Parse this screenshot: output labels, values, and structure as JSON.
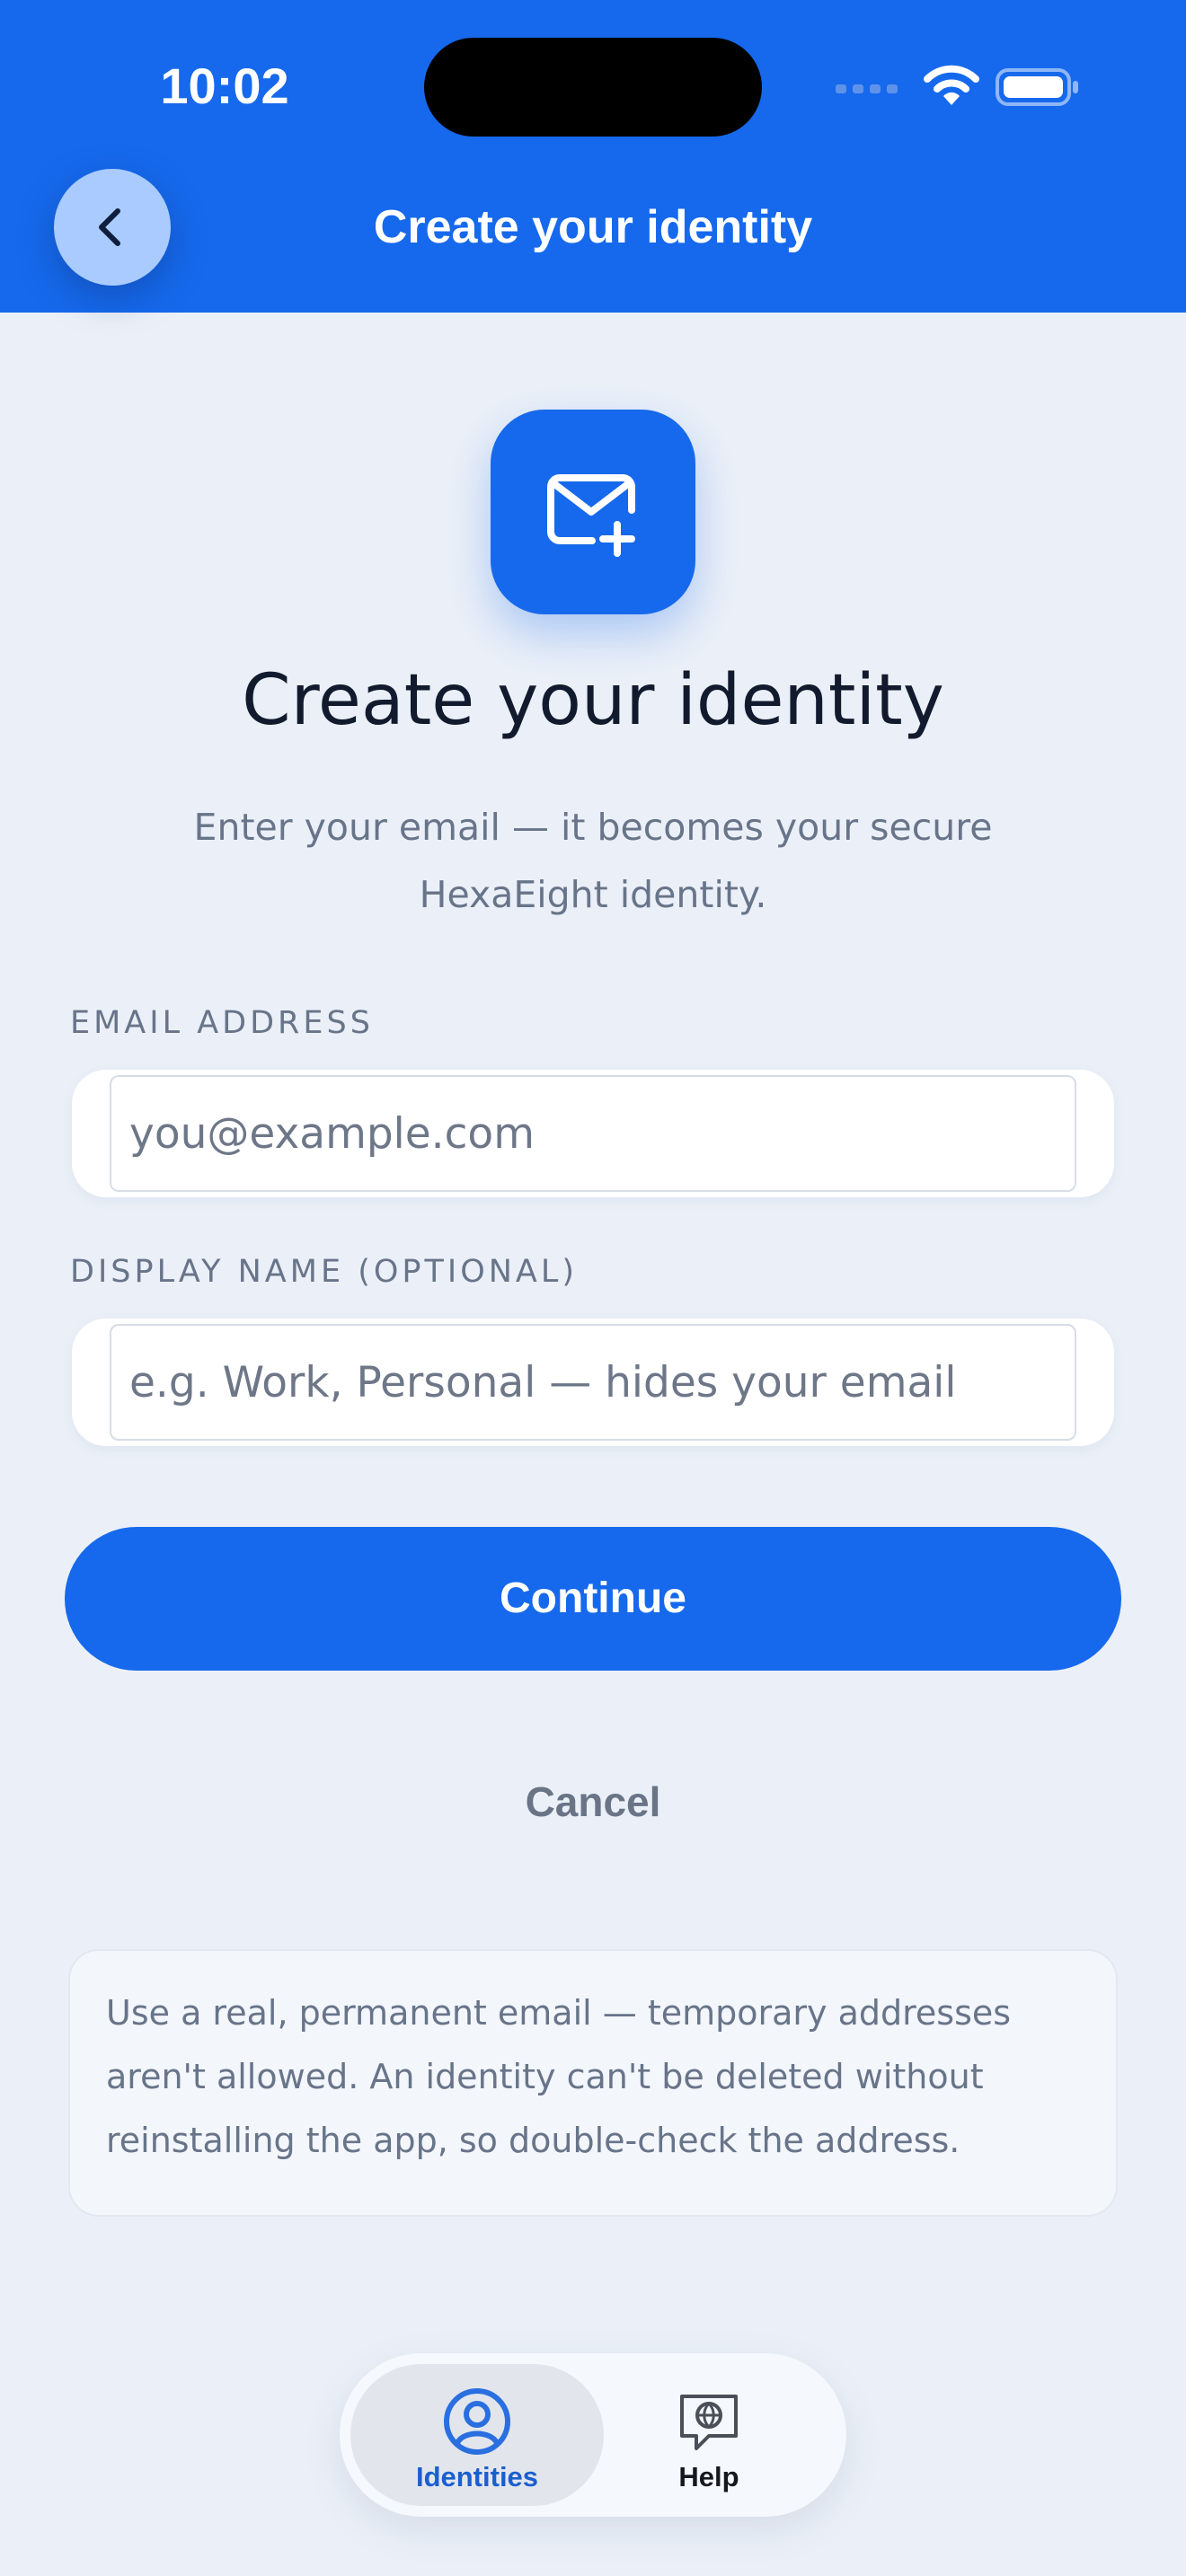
{
  "status_bar": {
    "time": "10:02"
  },
  "header": {
    "title": "Create your identity",
    "back_icon": "chevron-left-icon",
    "background_color": "#1669ec"
  },
  "hero": {
    "icon": "mail-plus-icon",
    "title": "Create your identity",
    "subtitle": "Enter your email — it becomes your secure HexaEight identity."
  },
  "form": {
    "email": {
      "label": "EMAIL ADDRESS",
      "value": "",
      "placeholder": "you@example.com"
    },
    "display_name": {
      "label": "DISPLAY NAME (OPTIONAL)",
      "value": "",
      "placeholder": "e.g. Work, Personal — hides your email"
    }
  },
  "actions": {
    "continue_label": "Continue",
    "cancel_label": "Cancel"
  },
  "notice": {
    "text": "Use a real, permanent email — temporary addresses aren't allowed. An identity can't be deleted without reinstalling the app, so double-check the address."
  },
  "tab_bar": {
    "tabs": [
      {
        "label": "Identities",
        "icon": "person-circle-icon",
        "active": true
      },
      {
        "label": "Help",
        "icon": "chat-globe-icon",
        "active": false
      }
    ]
  },
  "colors": {
    "accent": "#1669ec",
    "background": "#ebf0f8",
    "muted_text": "#687489",
    "tab_active_text": "#1a5fd1"
  }
}
